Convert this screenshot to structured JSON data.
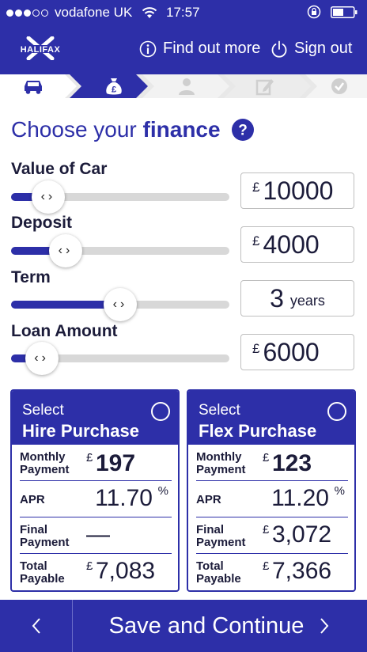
{
  "status_bar": {
    "carrier": "vodafone UK",
    "time": "17:57",
    "signal_bars_filled": 3,
    "signal_bars_total": 5
  },
  "header": {
    "logo_text": "HALIFAX",
    "find_out_more": "Find out more",
    "sign_out": "Sign out"
  },
  "steps": {
    "active_index": 1,
    "items": [
      "car-icon",
      "money-bag-icon",
      "person-icon",
      "edit-icon",
      "check-icon"
    ]
  },
  "title": {
    "prefix": "Choose your",
    "emphasis": "finance"
  },
  "fields": {
    "value_of_car": {
      "label": "Value of Car",
      "currency": "£",
      "value": "10000",
      "slider_fraction": 0.17
    },
    "deposit": {
      "label": "Deposit",
      "currency": "£",
      "value": "4000",
      "slider_fraction": 0.25
    },
    "term": {
      "label": "Term",
      "value": "3",
      "unit": "years",
      "slider_fraction": 0.5
    },
    "loan_amount": {
      "label": "Loan Amount",
      "currency": "£",
      "value": "6000",
      "slider_fraction": 0.14
    }
  },
  "cards": {
    "hire_purchase": {
      "select_label": "Select",
      "name": "Hire Purchase",
      "monthly_label": "Monthly Payment",
      "monthly_value": "197",
      "apr_label": "APR",
      "apr_value": "11.70",
      "apr_unit": "%",
      "final_label": "Final Payment",
      "final_value": "—",
      "total_label": "Total Payable",
      "total_value": "7,083"
    },
    "flex_purchase": {
      "select_label": "Select",
      "name": "Flex Purchase",
      "monthly_label": "Monthly Payment",
      "monthly_value": "123",
      "apr_label": "APR",
      "apr_value": "11.20",
      "apr_unit": "%",
      "final_label": "Final Payment",
      "final_value": "3,072",
      "total_label": "Total Payable",
      "total_value": "7,366"
    },
    "currency": "£"
  },
  "footer": {
    "save_label": "Save and Continue"
  },
  "colors": {
    "brand": "#2d2fa8",
    "track": "#d8d8d8",
    "inactive_step": "#c8c8c8"
  }
}
